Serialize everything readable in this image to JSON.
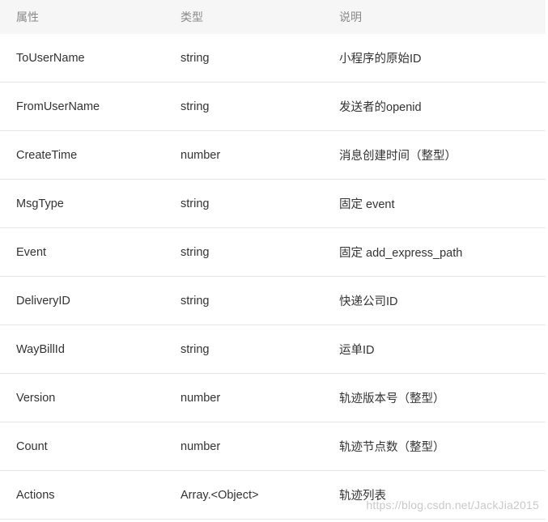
{
  "table": {
    "headers": [
      "属性",
      "类型",
      "说明"
    ],
    "rows": [
      {
        "name": "ToUserName",
        "type": "string",
        "desc": "小程序的原始ID"
      },
      {
        "name": "FromUserName",
        "type": "string",
        "desc": "发送者的openid"
      },
      {
        "name": "CreateTime",
        "type": "number",
        "desc": "消息创建时间（整型）"
      },
      {
        "name": "MsgType",
        "type": "string",
        "desc": "固定 event"
      },
      {
        "name": "Event",
        "type": "string",
        "desc": "固定 add_express_path"
      },
      {
        "name": "DeliveryID",
        "type": "string",
        "desc": "快递公司ID"
      },
      {
        "name": "WayBillId",
        "type": "string",
        "desc": "运单ID"
      },
      {
        "name": "Version",
        "type": "number",
        "desc": "轨迹版本号（整型）"
      },
      {
        "name": "Count",
        "type": "number",
        "desc": "轨迹节点数（整型）"
      },
      {
        "name": "Actions",
        "type": "Array.<Object>",
        "desc": "轨迹列表"
      }
    ]
  },
  "watermark": "https://blog.csdn.net/JackJia2015"
}
